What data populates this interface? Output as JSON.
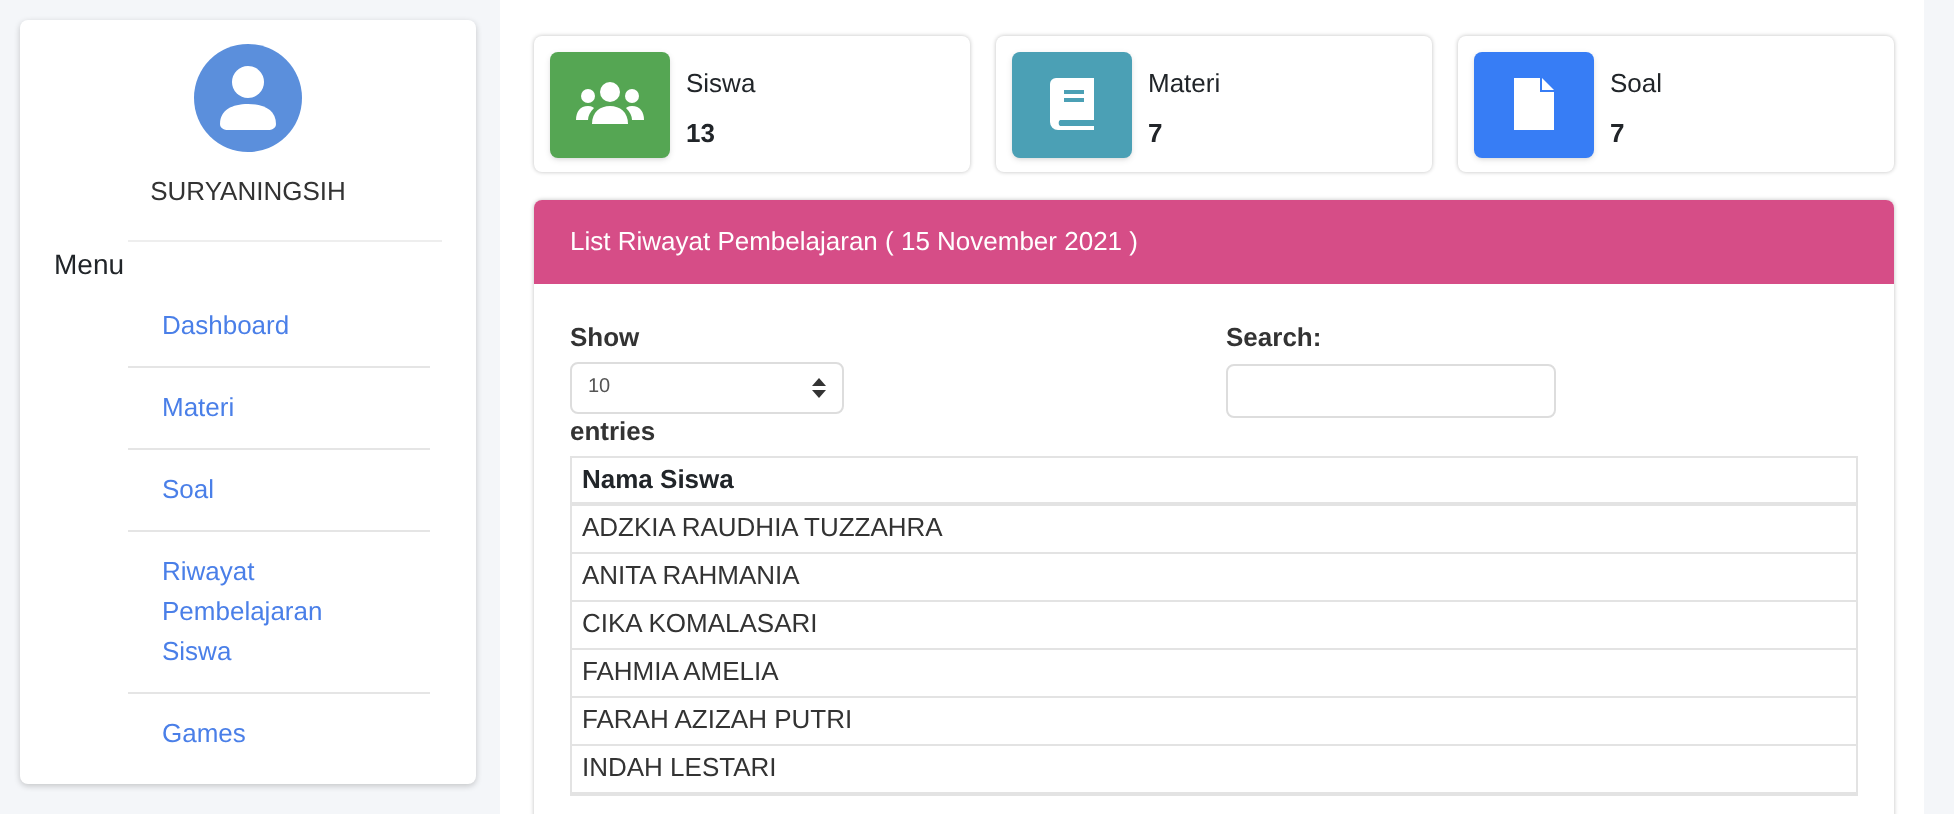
{
  "sidebar": {
    "user": "SURYANINGSIH",
    "menu_title": "Menu",
    "items": [
      {
        "label": "Dashboard"
      },
      {
        "label": "Materi"
      },
      {
        "label": "Soal"
      },
      {
        "label": "Riwayat Pembelajaran Siswa"
      },
      {
        "label": "Games"
      }
    ]
  },
  "stats": [
    {
      "kind": "users",
      "label": "Siswa",
      "value": "13",
      "color": "#55a653"
    },
    {
      "kind": "book",
      "label": "Materi",
      "value": "7",
      "color": "#4ba0b5"
    },
    {
      "kind": "file",
      "label": "Soal",
      "value": "7",
      "color": "#377df5"
    }
  ],
  "panel": {
    "title": "List Riwayat Pembelajaran ( 15 November 2021 )",
    "show_label": "Show",
    "page_size": "10",
    "entries_label": "entries",
    "search_label": "Search:",
    "table": {
      "columns": [
        "Nama Siswa"
      ],
      "rows": [
        [
          "ADZKIA RAUDHIA TUZZAHRA"
        ],
        [
          "ANITA RAHMANIA"
        ],
        [
          "CIKA KOMALASARI"
        ],
        [
          "FAHMIA AMELIA"
        ],
        [
          "FARAH AZIZAH PUTRI"
        ],
        [
          "INDAH LESTARI"
        ]
      ]
    }
  }
}
